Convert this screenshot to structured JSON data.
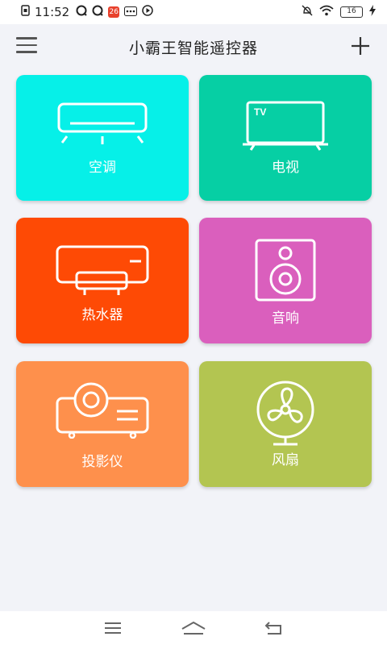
{
  "status_bar": {
    "time": "11:52",
    "battery": "16",
    "left_icons": [
      "sim-card-icon",
      "chat-bubble-icon",
      "chat-bubble-icon",
      "notification-badge-icon",
      "ellipsis-icon",
      "play-icon"
    ],
    "right_icons": [
      "do-not-disturb-icon",
      "wifi-icon",
      "battery-icon",
      "charging-icon"
    ]
  },
  "header": {
    "title": "小霸王智能遥控器"
  },
  "devices": [
    {
      "id": "air-conditioner",
      "label": "空调",
      "color": "#06f0e8",
      "icon": "air-conditioner-icon"
    },
    {
      "id": "tv",
      "label": "电视",
      "color": "#06cfa4",
      "icon": "tv-icon"
    },
    {
      "id": "water-heater",
      "label": "热水器",
      "color": "#fe4a05",
      "icon": "water-heater-icon"
    },
    {
      "id": "speaker",
      "label": "音响",
      "color": "#da5fbd",
      "icon": "speaker-icon"
    },
    {
      "id": "projector",
      "label": "投影仪",
      "color": "#fe904c",
      "icon": "projector-icon"
    },
    {
      "id": "fan",
      "label": "风扇",
      "color": "#b3c551",
      "icon": "fan-icon"
    }
  ],
  "tv_icon_text": "TV",
  "nav": [
    "menu-icon",
    "home-icon",
    "back-icon"
  ]
}
